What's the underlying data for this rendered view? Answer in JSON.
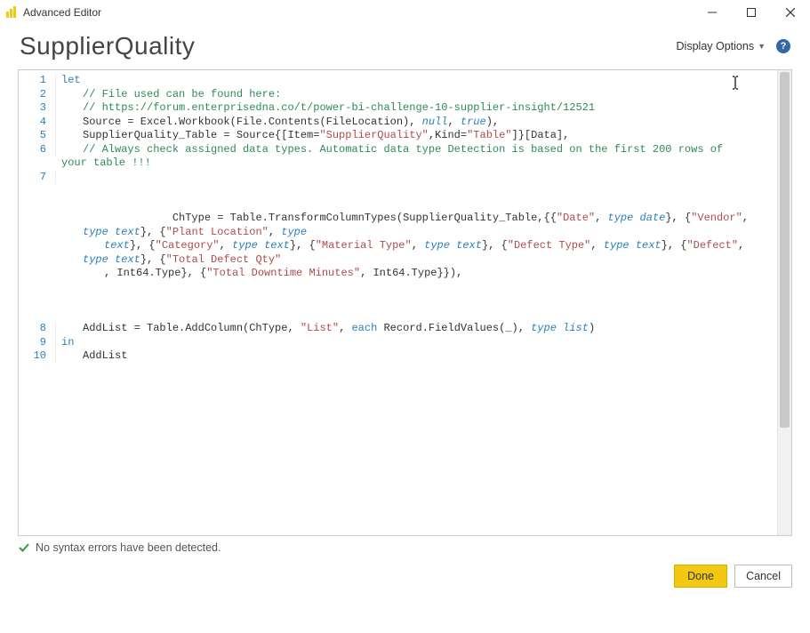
{
  "window": {
    "title": "Advanced Editor"
  },
  "header": {
    "query_name": "SupplierQuality",
    "display_options_label": "Display Options",
    "help_glyph": "?"
  },
  "code": {
    "l1": {
      "num": "1",
      "kw": "let"
    },
    "l2": {
      "num": "2",
      "cm": "// File used can be found here:"
    },
    "l3": {
      "num": "3",
      "cm": "// https://forum.enterprisedna.co/t/power-bi-challenge-10-supplier-insight/12521"
    },
    "l4": {
      "num": "4",
      "a": "Source = Excel.Workbook(File.Contents(FileLocation), ",
      "null": "null",
      "b": ", ",
      "true": "true",
      "c": "),"
    },
    "l5": {
      "num": "5",
      "a": "SupplierQuality_Table = Source{[Item=",
      "s1": "\"SupplierQuality\"",
      "b": ",Kind=",
      "s2": "\"Table\"",
      "c": "]}[Data],"
    },
    "l6": {
      "num": "6",
      "cm": "// Always check assigned data types. Automatic data type Detection is based on the first 200 rows of your table !!!"
    },
    "l7": {
      "num": "7",
      "a": "ChType = Table.TransformColumnTypes(SupplierQuality_Table,{{",
      "s1": "\"Date\"",
      "t": "type",
      "tv1": "date",
      "b1": "}, {",
      "s2": "\"Vendor\"",
      "tv2": "text",
      "b2": "}, {",
      "s3": "\"Plant Location\"",
      "tv3": "text",
      "b3": "}, {",
      "s4": "\"Category\"",
      "tv4": "text",
      "b4": "}, {",
      "s5": "\"Material Type\"",
      "tv5": "text",
      "b5": "}, {",
      "s6": "\"Defect Type\"",
      "tv6": "text",
      "b6": "}, {",
      "s7": "\"Defect\"",
      "tv7": "text",
      "b7": "}, {",
      "s8": "\"Total Defect Qty\"",
      "int": "Int64.Type",
      "b8": "}, {",
      "s9": "\"Total Downtime Minutes\"",
      "b9": ", Int64.Type}}),"
    },
    "l8": {
      "num": "8",
      "a": "AddList = Table.AddColumn(ChType, ",
      "s1": "\"List\"",
      "b": ", ",
      "each": "each",
      "c": " Record.FieldValues(_), ",
      "t": "type",
      "tv": "list",
      "d": ")"
    },
    "l9": {
      "num": "9",
      "kw": "in"
    },
    "l10": {
      "num": "10",
      "a": "AddList"
    }
  },
  "status": {
    "text": "No syntax errors have been detected."
  },
  "footer": {
    "done": "Done",
    "cancel": "Cancel"
  }
}
